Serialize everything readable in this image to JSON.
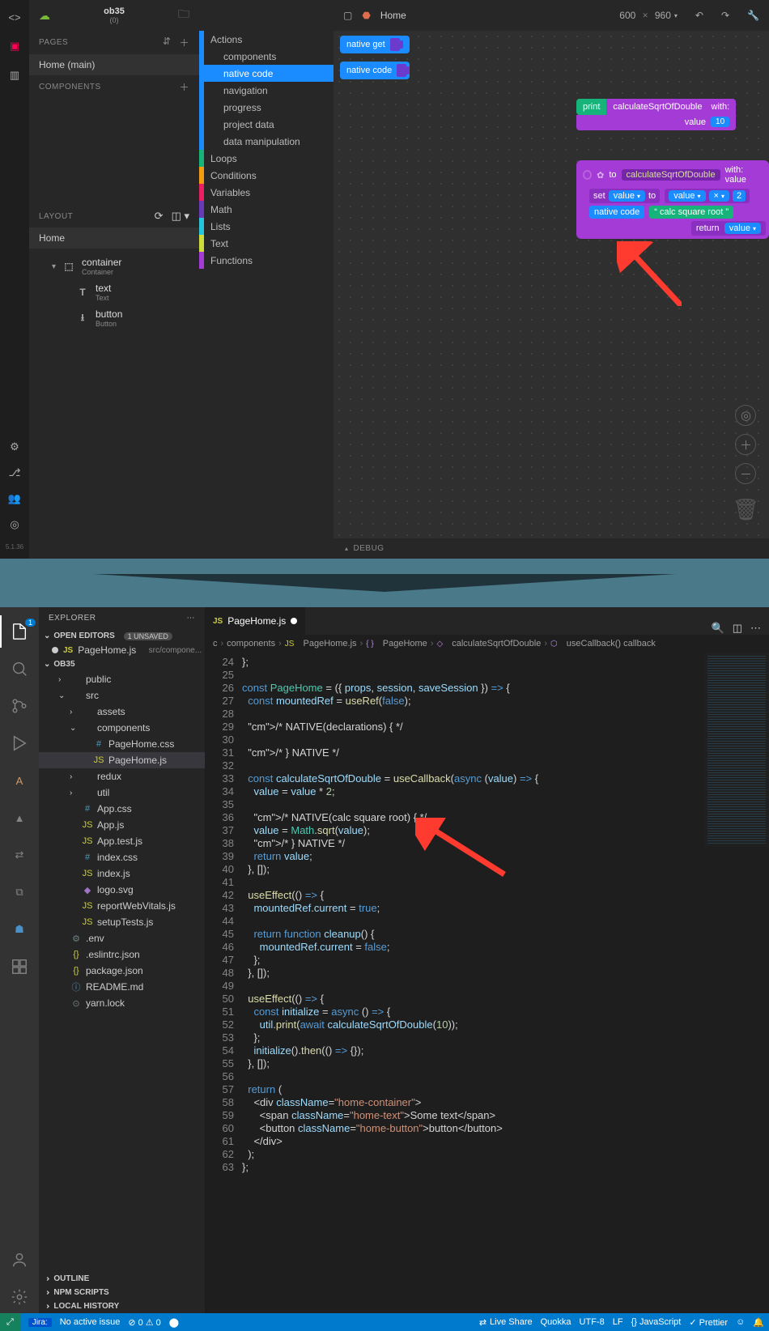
{
  "upper": {
    "project": {
      "name": "ob35",
      "count": "(0)"
    },
    "breadcrumb": "Home",
    "dims": {
      "w": "600",
      "h": "960"
    },
    "pages_h": "PAGES",
    "page": "Home (main)",
    "components_h": "COMPONENTS",
    "layout_h": "LAYOUT",
    "layout_home": "Home",
    "tree": {
      "container": {
        "t": "container",
        "s": "Container"
      },
      "text": {
        "t": "text",
        "s": "Text"
      },
      "button": {
        "t": "button",
        "s": "Button"
      }
    },
    "debug": "DEBUG",
    "version": "5.1.36",
    "mid": {
      "actions": "Actions",
      "sub": [
        "components",
        "native code",
        "navigation",
        "progress",
        "project data",
        "data manipulation"
      ],
      "loops": "Loops",
      "conditions": "Conditions",
      "variables": "Variables",
      "math": "Math",
      "lists": "Lists",
      "text": "Text",
      "functions": "Functions"
    },
    "pal": {
      "nget": "native get",
      "ncode": "native code"
    },
    "blocks": {
      "print": "print",
      "calc": "calculateSqrtOfDouble",
      "with": "with:",
      "value": "value",
      "ten": "10",
      "to": "to",
      "withv": "with: value",
      "set": "set",
      "to2": "to",
      "x": "×",
      "two": "2",
      "ncode": "native code",
      "str": "calc square root",
      "ret": "return"
    }
  },
  "lower": {
    "explorer": "EXPLORER",
    "open_ed": "OPEN EDITORS",
    "unsaved": "1 UNSAVED",
    "open_file": {
      "name": "PageHome.js",
      "path": "src/compone..."
    },
    "root": "OB35",
    "tab_name": "PageHome.js",
    "bread": [
      "c",
      "components",
      "PageHome.js",
      "PageHome",
      "calculateSqrtOfDouble",
      "useCallback() callback"
    ],
    "tree": [
      {
        "d": 1,
        "chev": ">",
        "ic": "",
        "cls": "",
        "lbl": "public"
      },
      {
        "d": 1,
        "chev": "v",
        "ic": "",
        "cls": "",
        "lbl": "src"
      },
      {
        "d": 2,
        "chev": ">",
        "ic": "",
        "cls": "",
        "lbl": "assets"
      },
      {
        "d": 2,
        "chev": "v",
        "ic": "",
        "cls": "",
        "lbl": "components"
      },
      {
        "d": 3,
        "chev": "",
        "ic": "#",
        "cls": "c-css",
        "lbl": "PageHome.css"
      },
      {
        "d": 3,
        "chev": "",
        "ic": "JS",
        "cls": "c-js",
        "lbl": "PageHome.js",
        "sel": true
      },
      {
        "d": 2,
        "chev": ">",
        "ic": "",
        "cls": "",
        "lbl": "redux"
      },
      {
        "d": 2,
        "chev": ">",
        "ic": "",
        "cls": "",
        "lbl": "util"
      },
      {
        "d": 2,
        "chev": "",
        "ic": "#",
        "cls": "c-css",
        "lbl": "App.css"
      },
      {
        "d": 2,
        "chev": "",
        "ic": "JS",
        "cls": "c-js",
        "lbl": "App.js"
      },
      {
        "d": 2,
        "chev": "",
        "ic": "JS",
        "cls": "c-js",
        "lbl": "App.test.js"
      },
      {
        "d": 2,
        "chev": "",
        "ic": "#",
        "cls": "c-css",
        "lbl": "index.css"
      },
      {
        "d": 2,
        "chev": "",
        "ic": "JS",
        "cls": "c-js",
        "lbl": "index.js"
      },
      {
        "d": 2,
        "chev": "",
        "ic": "◆",
        "cls": "c-svg",
        "lbl": "logo.svg"
      },
      {
        "d": 2,
        "chev": "",
        "ic": "JS",
        "cls": "c-js",
        "lbl": "reportWebVitals.js"
      },
      {
        "d": 2,
        "chev": "",
        "ic": "JS",
        "cls": "c-js",
        "lbl": "setupTests.js"
      },
      {
        "d": 1,
        "chev": "",
        "ic": "⚙",
        "cls": "c-env",
        "lbl": ".env"
      },
      {
        "d": 1,
        "chev": "",
        "ic": "{}",
        "cls": "c-json",
        "lbl": ".eslintrc.json"
      },
      {
        "d": 1,
        "chev": "",
        "ic": "{}",
        "cls": "c-json",
        "lbl": "package.json"
      },
      {
        "d": 1,
        "chev": "",
        "ic": "ⓘ",
        "cls": "c-md",
        "lbl": "README.md"
      },
      {
        "d": 1,
        "chev": "",
        "ic": "⊙",
        "cls": "c-env",
        "lbl": "yarn.lock"
      }
    ],
    "sects": [
      "OUTLINE",
      "NPM SCRIPTS",
      "LOCAL HISTORY"
    ],
    "code": {
      "start": 24,
      "lines": [
        "};",
        "",
        "const PageHome = ({ props, session, saveSession }) => {",
        "  const mountedRef = useRef(false);",
        "",
        "  /* NATIVE(declarations) { */",
        "",
        "  /* } NATIVE */",
        "",
        "  const calculateSqrtOfDouble = useCallback(async (value) => {",
        "    value = value * 2;",
        "",
        "    /* NATIVE(calc square root) { */",
        "    value = Math.sqrt(value);",
        "    /* } NATIVE */",
        "    return value;",
        "  }, []);",
        "",
        "  useEffect(() => {",
        "    mountedRef.current = true;",
        "",
        "    return function cleanup() {",
        "      mountedRef.current = false;",
        "    };",
        "  }, []);",
        "",
        "  useEffect(() => {",
        "    const initialize = async () => {",
        "      util.print(await calculateSqrtOfDouble(10));",
        "    };",
        "    initialize().then(() => {});",
        "  }, []);",
        "",
        "  return (",
        "    <div className=\"home-container\">",
        "      <span className=\"home-text\">Some text</span>",
        "      <button className=\"home-button\">button</button>",
        "    </div>",
        "  );",
        "};"
      ]
    },
    "status": {
      "jira": "Jira:",
      "noissue": "No active issue",
      "err": "⊘ 0 ⚠ 0",
      "rec": "⬤",
      "live": "Live Share",
      "quokka": "Quokka",
      "enc": "UTF-8",
      "eol": "LF",
      "lang": "{} JavaScript",
      "pret": "✓ Prettier"
    }
  }
}
